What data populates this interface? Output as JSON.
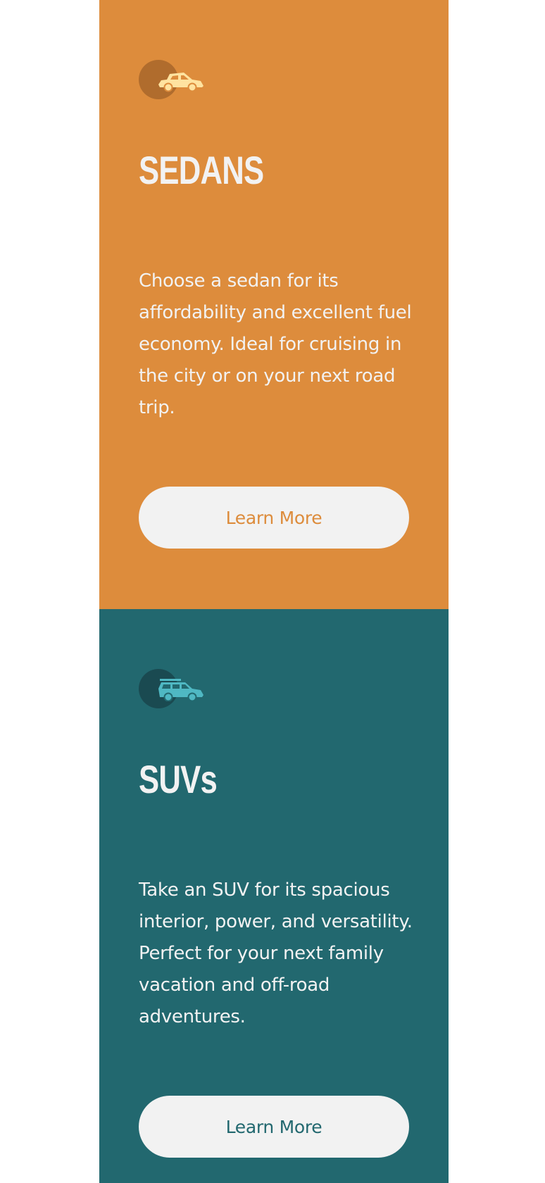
{
  "cards": [
    {
      "id": "sedans",
      "title": "SEDANS",
      "description": "Choose a sedan for its affordability and excellent fuel economy. Ideal for cruising in the city or on your next road trip.",
      "button_label": "Learn More",
      "icon": "sedan-car-icon",
      "background_color": "#dd8c3c",
      "accent_color": "#ffe3a0"
    },
    {
      "id": "suvs",
      "title": "SUVs",
      "description": "Take an SUV for its spacious interior, power, and versatility. Perfect for your next family vacation and off-road adventures.",
      "button_label": "Learn More",
      "icon": "suv-car-icon",
      "background_color": "#22686f",
      "accent_color": "#4fb8c3"
    }
  ]
}
